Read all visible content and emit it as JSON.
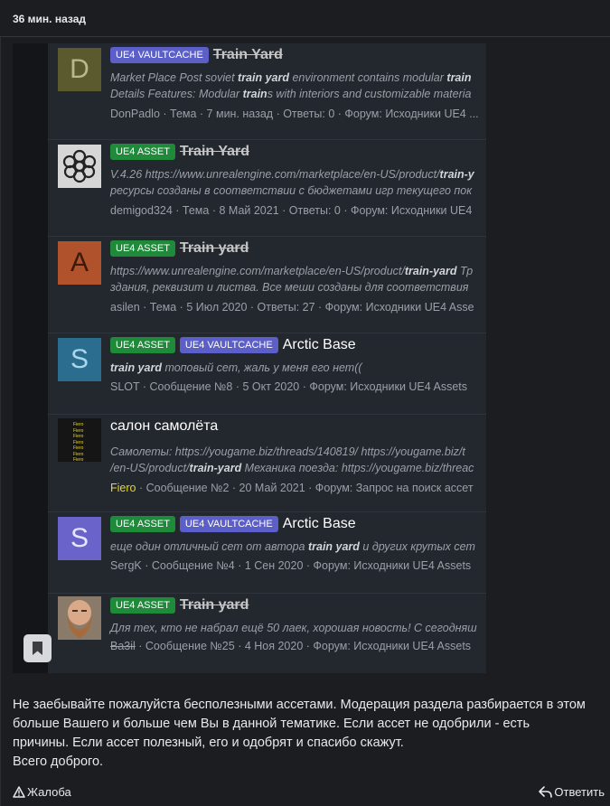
{
  "post": {
    "time": "36 мин. назад",
    "text_lines": [
      "Не заебывайте пожалуйста бесполезными ассетами. Модерация раздела разбирается в этом",
      "больше Вашего и больше чем Вы в данной тематике. Если ассет не одобрили - есть",
      "причины. Если ассет полезный, его и одобрят и спасибо скажут.",
      "Всего доброго."
    ],
    "report_label": "Жалоба",
    "reply_label": "Ответить"
  },
  "results": [
    {
      "avatar_letter": "D",
      "avatar_color": "#5b5a2e",
      "badges": [
        "UE4 VAULTCACHE"
      ],
      "title": "Train Yard",
      "snippet1": "Market Place Post soviet <b>train yard</b> environment contains modular <b>train</b>",
      "snippet2": "Details Features: Modular <b>train</b>s with interiors and customizable materia",
      "author": "DonPadlo",
      "meta": " · Тема · 7 мин. назад · Ответы: 0 · Форум: Исходники UE4 ..."
    },
    {
      "avatar_letter": "",
      "avatar_color": "#d6d6d6",
      "badges": [
        "UE4 ASSET"
      ],
      "title": "Train Yard",
      "snippet1": "V.4.26 https://www.unrealengine.com/marketplace/en-US/product/<b>train-y</b>",
      "snippet2": "ресурсы созданы в соответствии с бюджетами игр текущего пок",
      "author": "demigod324",
      "meta": " · Тема · 8 Май 2021 · Ответы: 0 · Форум: Исходники UE4"
    },
    {
      "avatar_letter": "A",
      "avatar_color": "#b0522b",
      "badges": [
        "UE4 ASSET"
      ],
      "title": "Train yard",
      "snippet1": "https://www.unrealengine.com/marketplace/en-US/product/<b>train-yard</b> Тр",
      "snippet2": "здания, реквизит и листва. Все меши созданы для соответствия",
      "author": "asilen",
      "meta": " · Тема · 5 Июл 2020 · Ответы: 27 · Форум: Исходники UE4 Asse"
    },
    {
      "avatar_letter": "S",
      "avatar_color": "#2a6d8f",
      "badges": [
        "UE4 ASSET",
        "UE4 VAULTCACHE"
      ],
      "title": "Arctic Base",
      "snippet1": "<b>train yard</b> топовый сет, жаль у меня его нет((",
      "author": "SLOT",
      "meta": " · Сообщение №8 · 5 Окт 2020 · Форум: Исходники UE4 Assets"
    },
    {
      "avatar_letter": "",
      "avatar_color": "#151515",
      "badges": [],
      "title": "салон самолёта",
      "snippet1": "Самолеты: https://yougame.biz/threads/140819/ https://yougame.biz/t",
      "snippet2": "/en-US/product/<b>train-yard</b> Механика поезда: https://yougame.biz/threac",
      "author": "Fiero",
      "meta": " · Сообщение №2 · 20 Май 2021 · Форум: Запрос на поиск ассет"
    },
    {
      "avatar_letter": "S",
      "avatar_color": "#6a63c9",
      "badges": [
        "UE4 ASSET",
        "UE4 VAULTCACHE"
      ],
      "title": "Arctic Base",
      "snippet1": "еще один отличный сет от автора <b>train yard</b> и других крутых сет",
      "author": "SergK",
      "meta": " · Сообщение №4 · 1 Сен 2020 · Форум: Исходники UE4 Assets"
    },
    {
      "avatar_letter": "",
      "avatar_color": "#a08870",
      "badges": [
        "UE4 ASSET"
      ],
      "title": "Train yard",
      "snippet1": "Для тех, кто не набрал ещё 50 лаек, хорошая новость! С сегодняш",
      "author": "Ba3il",
      "meta": " · Сообщение №25 · 4 Ноя 2020 · Форум: Исходники UE4 Assets"
    }
  ],
  "fiero_avatar_text": "Fiero"
}
